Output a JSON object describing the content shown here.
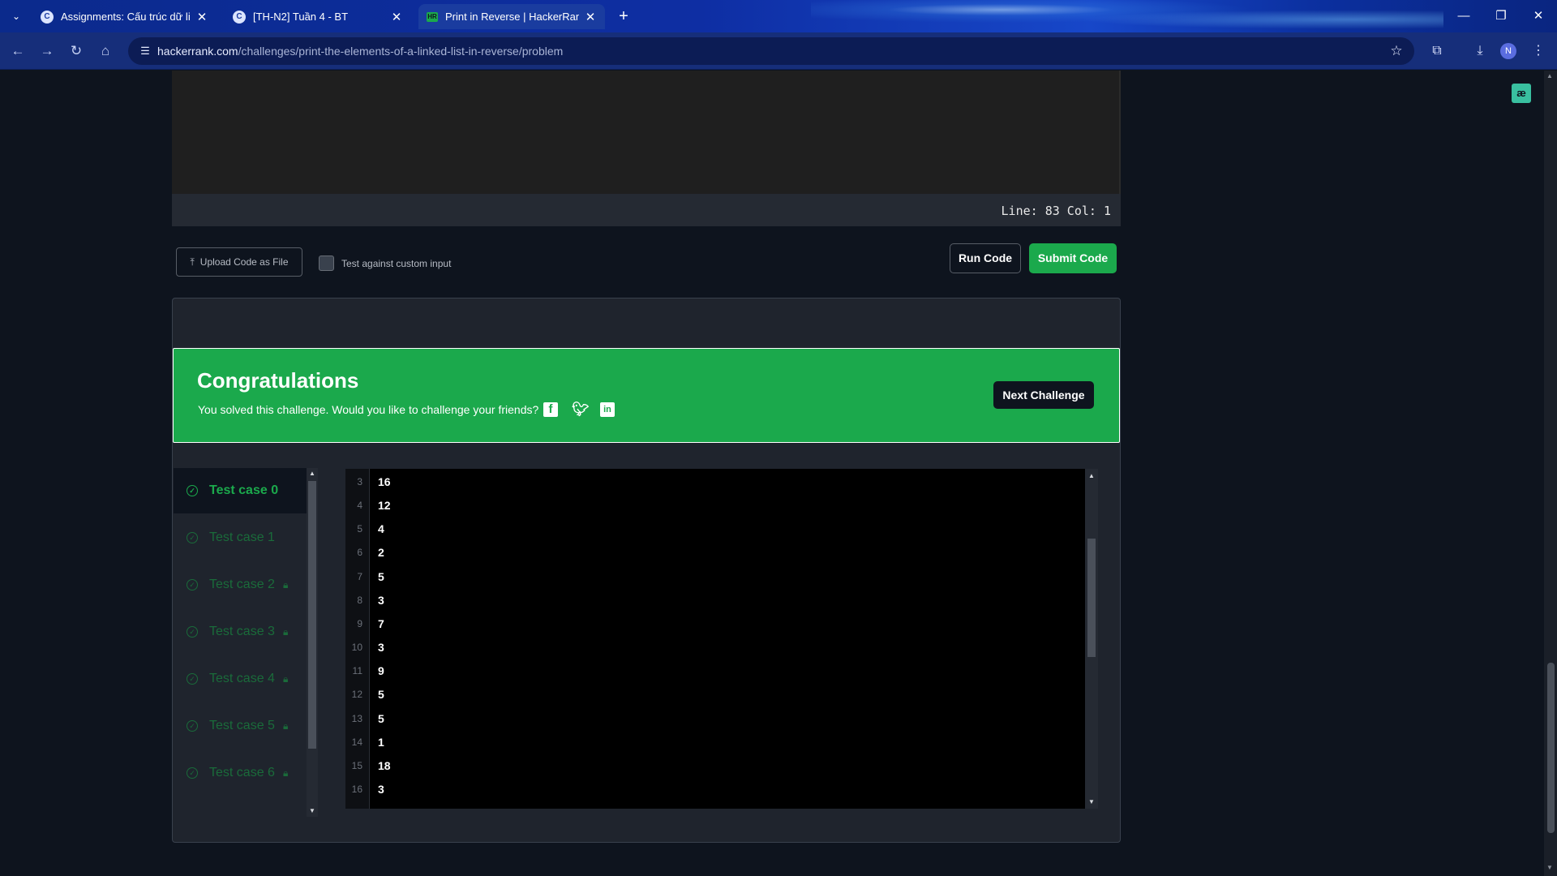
{
  "browser": {
    "tabs": [
      {
        "label": "Assignments: Cấu trúc dữ liệu và",
        "favicon": "C",
        "active": false
      },
      {
        "label": "[TH-N2] Tuần 4 - BT",
        "favicon": "C",
        "active": false
      },
      {
        "label": "Print in Reverse | HackerRank",
        "favicon": "HR",
        "active": true
      }
    ],
    "url_host": "hackerrank.com",
    "url_path": "/challenges/print-the-elements-of-a-linked-list-in-reverse/problem",
    "profile_initial": "N",
    "window_controls": {
      "minimize": "—",
      "restore": "❐",
      "close": "✕"
    }
  },
  "editor": {
    "status": "Line: 83 Col: 1"
  },
  "actions": {
    "upload_label": "Upload Code as File",
    "custom_input_label": "Test against custom input",
    "run_label": "Run Code",
    "submit_label": "Submit Code"
  },
  "congrats": {
    "title": "Congratulations",
    "message": "You solved this challenge. Would you like to challenge your friends?",
    "next_label": "Next Challenge"
  },
  "test_cases": [
    {
      "label": "Test case 0",
      "locked": false,
      "active": true
    },
    {
      "label": "Test case 1",
      "locked": false,
      "active": false
    },
    {
      "label": "Test case 2",
      "locked": true,
      "active": false
    },
    {
      "label": "Test case 3",
      "locked": true,
      "active": false
    },
    {
      "label": "Test case 4",
      "locked": true,
      "active": false
    },
    {
      "label": "Test case 5",
      "locked": true,
      "active": false
    },
    {
      "label": "Test case 6",
      "locked": true,
      "active": false
    }
  ],
  "output": {
    "line_numbers": [
      "3",
      "4",
      "5",
      "6",
      "7",
      "8",
      "9",
      "10",
      "11",
      "12",
      "13",
      "14",
      "15",
      "16"
    ],
    "lines": [
      "16",
      "12",
      "4",
      "2",
      "5",
      "3",
      "7",
      "3",
      "9",
      "5",
      "5",
      "1",
      "18",
      "3"
    ]
  },
  "colors": {
    "accent": "#1ba94c",
    "background": "#0e141e",
    "panel": "#1f242d"
  }
}
